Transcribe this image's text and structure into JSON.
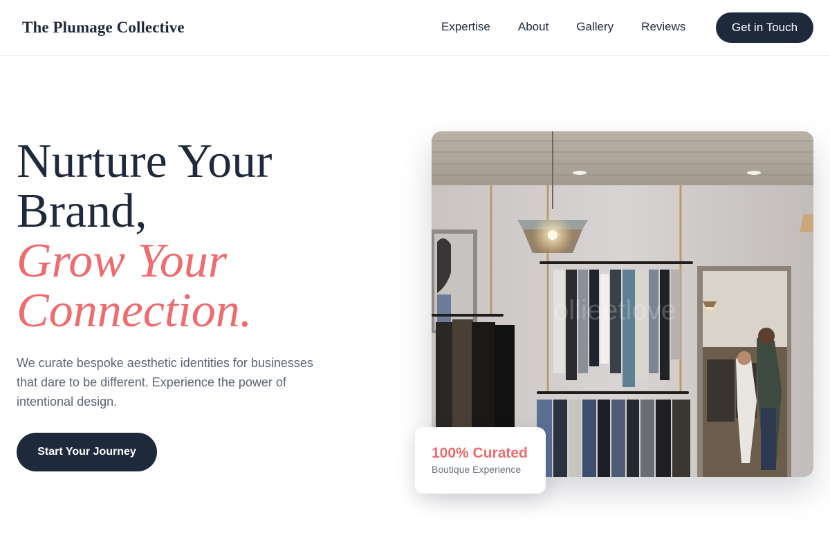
{
  "header": {
    "brand": "The Plumage Collective",
    "nav": [
      "Expertise",
      "About",
      "Gallery",
      "Reviews"
    ],
    "cta_label": "Get in Touch"
  },
  "hero": {
    "headline_line1": "Nurture Your",
    "headline_line2": "Brand,",
    "headline_accent_line1": "Grow Your",
    "headline_accent_line2": "Connection.",
    "description": "We curate bespoke aesthetic identities for businesses that dare to be different. Experience the power of intentional design.",
    "cta_label": "Start Your Journey",
    "image_watermark": "ollieetlove",
    "badge_title": "100% Curated",
    "badge_subtitle": "Boutique Experience"
  },
  "colors": {
    "primary_dark": "#1e293b",
    "accent_coral": "#ee6b6e",
    "muted_text": "#5a6474"
  }
}
